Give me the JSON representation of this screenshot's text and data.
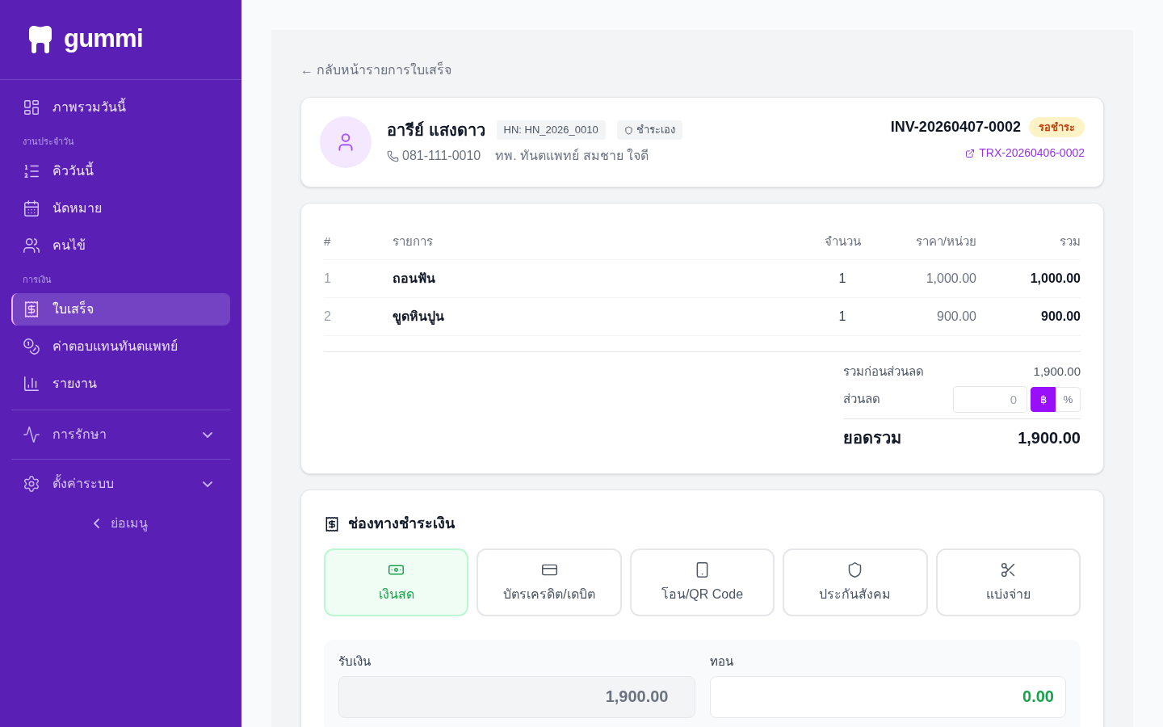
{
  "sidebar": {
    "logo": "gummi",
    "nav": [
      {
        "kind": "link",
        "label": "ภาพรวมวันนี้",
        "selected": false
      },
      {
        "kind": "section",
        "label": "งานประจำวัน"
      },
      {
        "kind": "link",
        "label": "คิววันนี้",
        "selected": false
      },
      {
        "kind": "link",
        "label": "นัดหมาย",
        "selected": false
      },
      {
        "kind": "link",
        "label": "คนไข้",
        "selected": false
      },
      {
        "kind": "section",
        "label": "การเงิน"
      },
      {
        "kind": "link",
        "label": "ใบเสร็จ",
        "selected": true
      },
      {
        "kind": "link",
        "label": "ค่าตอบแทนทันตแพทย์",
        "selected": false
      },
      {
        "kind": "link",
        "label": "รายงาน",
        "selected": false
      },
      {
        "kind": "group",
        "label": "การรักษา",
        "expanded": false
      },
      {
        "kind": "group",
        "label": "ตั้งค่าระบบ",
        "expanded": false
      }
    ],
    "collapse_button": "ย่อเมนู"
  },
  "back_link": "← กลับหน้ารายการใบเสร็จ",
  "patient": {
    "name": "อารีย์ แสงดาว",
    "hn": "HN: HN_2026_0010",
    "payer": "ชำระเอง",
    "phone": "081-111-0010",
    "doctor": "ทพ. ทันตแพทย์ สมชาย ใจดี"
  },
  "invoice": {
    "number": "INV-20260407-0002",
    "status": {
      "kind": "pending",
      "label": "รอชำระ"
    },
    "transaction_link": "TRX-20260406-0002"
  },
  "items_table": {
    "columns": [
      "#",
      "รายการ",
      "จำนวน",
      "ราคา/หน่วย",
      "รวม"
    ],
    "rows": [
      {
        "cells": [
          "1",
          "ถอนฟัน",
          "1",
          "1,000.00",
          "1,000.00"
        ]
      },
      {
        "cells": [
          "2",
          "ขูดหินปูน",
          "1",
          "900.00",
          "900.00"
        ]
      }
    ]
  },
  "summary": {
    "subtotal_label": "รวมก่อนส่วนลด",
    "subtotal": "1,900.00",
    "discount_label": "ส่วนลด",
    "discount_field": {
      "placeholder": "0"
    },
    "discount_units": [
      {
        "label": "฿",
        "selected": true
      },
      {
        "label": "%",
        "selected": false
      }
    ],
    "total_label": "ยอดรวม",
    "total": "1,900.00"
  },
  "payment": {
    "title": "ช่องทางชำระเงิน",
    "methods": [
      {
        "label": "เงินสด",
        "selected": true
      },
      {
        "label": "บัตรเครดิต/เดบิต",
        "selected": false
      },
      {
        "label": "โอน/QR Code",
        "selected": false
      },
      {
        "label": "ประกันสังคม",
        "selected": false
      },
      {
        "label": "แบ่งจ่าย",
        "selected": false
      }
    ],
    "received": {
      "label": "รับเงิน",
      "value": "1,900.00",
      "disabled": true
    },
    "change": {
      "label": "ทอน",
      "value": "0.00"
    }
  }
}
